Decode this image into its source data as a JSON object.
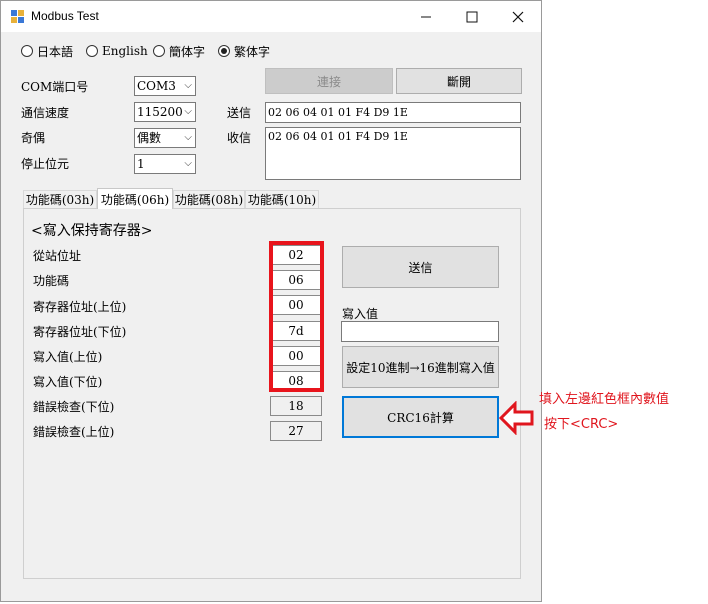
{
  "window": {
    "title": "Modbus Test"
  },
  "language_options": [
    {
      "label": "日本語",
      "selected": false
    },
    {
      "label": "English",
      "selected": false
    },
    {
      "label": "簡体字",
      "selected": false
    },
    {
      "label": "繁体字",
      "selected": true
    }
  ],
  "settings": {
    "com_label": "COM端口号",
    "com_value": "COM3",
    "speed_label": "通信速度",
    "speed_value": "115200",
    "parity_label": "奇偶",
    "parity_value": "偶數",
    "stopbit_label": "停止位元",
    "stopbit_value": "1"
  },
  "connection": {
    "connect_label": "連接",
    "disconnect_label": "斷開",
    "send_label": "送信",
    "send_value": "02 06 04 01 01 F4 D9 1E",
    "receive_label": "收信",
    "receive_value": "02 06 04 01 01 F4 D9 1E"
  },
  "tabs": [
    "功能碼(03h)",
    "功能碼(06h)",
    "功能碼(08h)",
    "功能碼(10h)"
  ],
  "active_tab": 1,
  "panel": {
    "heading": "<寫入保持寄存器>",
    "fields": [
      {
        "label": "從站位址",
        "value": "02"
      },
      {
        "label": "功能碼",
        "value": "06"
      },
      {
        "label": "寄存器位址(上位)",
        "value": "00"
      },
      {
        "label": "寄存器位址(下位)",
        "value": "7d"
      },
      {
        "label": "寫入值(上位)",
        "value": "00"
      },
      {
        "label": "寫入值(下位)",
        "value": "08"
      },
      {
        "label": "錯誤檢查(下位)",
        "value": "18"
      },
      {
        "label": "錯誤檢查(上位)",
        "value": "27"
      }
    ],
    "send_button": "送信",
    "write_value_label": "寫入值",
    "write_value": "",
    "convert_button": "設定10進制→16進制寫入值",
    "crc_button": "CRC16計算"
  },
  "annotation": {
    "line1": "填入左邊紅色框內數值",
    "line2": "按下<CRC>",
    "color": "#e0161e"
  }
}
